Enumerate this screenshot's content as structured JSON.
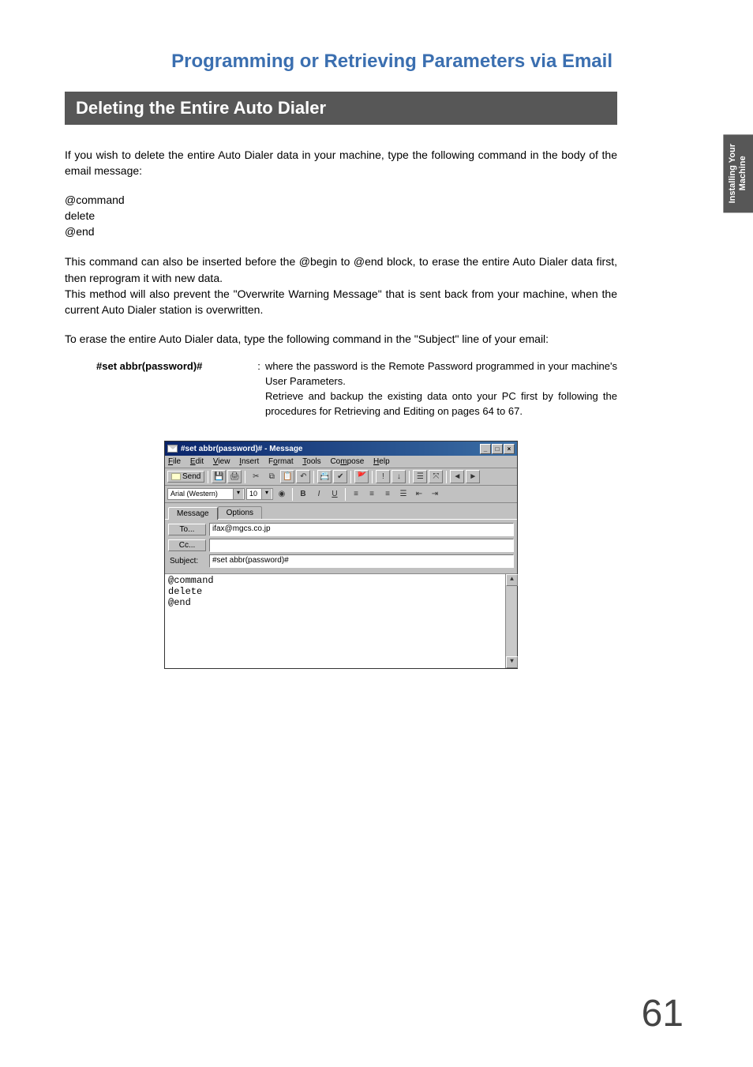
{
  "sidebar_tab": "Installing Your\nMachine",
  "chapter_title": "Programming or Retrieving Parameters via Email",
  "section_title": "Deleting the Entire Auto Dialer",
  "para1": "If you wish to delete the entire Auto Dialer data in your machine, type the following command in the body of the email message:",
  "cmd": {
    "l1": "@command",
    "l2": "delete",
    "l3": "@end"
  },
  "para2": "This command can also be inserted before the @begin to @end block, to erase the entire Auto Dialer data first, then reprogram it with new data.",
  "para3": "This method will also prevent the \"Overwrite Warning Message\" that is sent back from your machine, when the current Auto Dialer station is overwritten.",
  "para4": "To erase the entire Auto Dialer data, type the following command in the \"Subject\" line of your email:",
  "param": {
    "key": "#set abbr(password)#",
    "colon": ":",
    "desc": "where the password is the Remote Password programmed in your machine's User Parameters.\nRetrieve and backup the existing data onto your PC first by following the procedures for Retrieving and Editing on pages 64 to 67."
  },
  "email": {
    "title": "#set abbr(password)# - Message",
    "menu": {
      "file": "File",
      "edit": "Edit",
      "view": "View",
      "insert": "Insert",
      "format": "Format",
      "tools": "Tools",
      "compose": "Compose",
      "help": "Help"
    },
    "send_label": "Send",
    "font_name": "Arial (Western)",
    "font_size": "10",
    "tab_message": "Message",
    "tab_options": "Options",
    "to_label": "To...",
    "cc_label": "Cc...",
    "subject_label": "Subject:",
    "to_value": "ifax@mgcs.co.jp",
    "cc_value": "",
    "subject_value": "#set abbr(password)#",
    "body": "@command\ndelete\n@end"
  },
  "page_number": "61"
}
